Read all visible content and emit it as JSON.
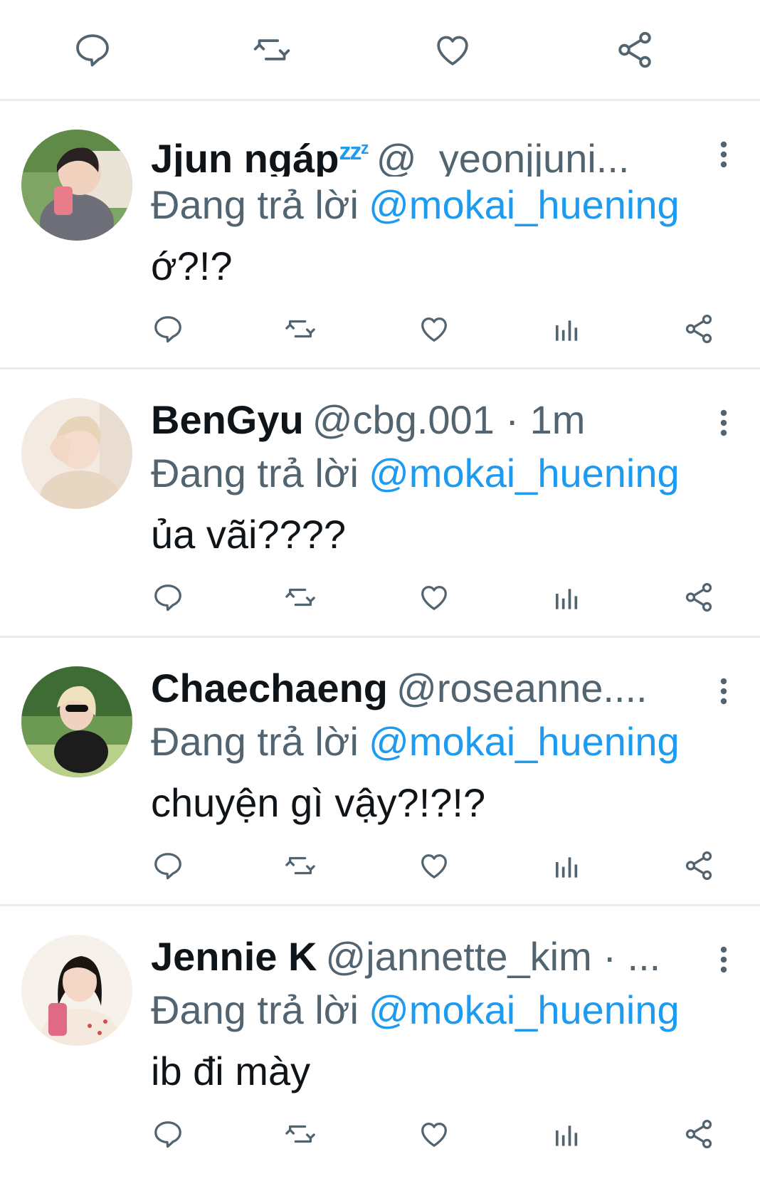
{
  "top_actions": {
    "icons": [
      "reply-icon",
      "retweet-icon",
      "like-icon",
      "share-icon"
    ]
  },
  "colors": {
    "text": "#0f1419",
    "muted": "#536471",
    "accent": "#1d9bf0",
    "divider": "#e6ecf0"
  },
  "tweets": [
    {
      "name": "Jjun ngáp",
      "name_suffix": "zzᶻ",
      "handle": "@_yeonjjuni...",
      "reply_prefix": "Đang trả lời",
      "reply_to": "@mokai_huening",
      "text": "ớ?!?"
    },
    {
      "name": "BenGyu",
      "name_suffix": "",
      "handle": "@cbg.001 · 1m",
      "reply_prefix": "Đang trả lời",
      "reply_to": "@mokai_huening",
      "text": "ủa vãi????"
    },
    {
      "name": "Chaechaeng",
      "name_suffix": "",
      "handle": "@roseanne....",
      "reply_prefix": "Đang trả lời",
      "reply_to": "@mokai_huening",
      "text": "chuyện gì vậy?!?!?"
    },
    {
      "name": "Jennie K",
      "name_suffix": "",
      "handle": "@jannette_kim · ...",
      "reply_prefix": "Đang trả lời",
      "reply_to": "@mokai_huening",
      "text": "ib đi mày"
    }
  ]
}
